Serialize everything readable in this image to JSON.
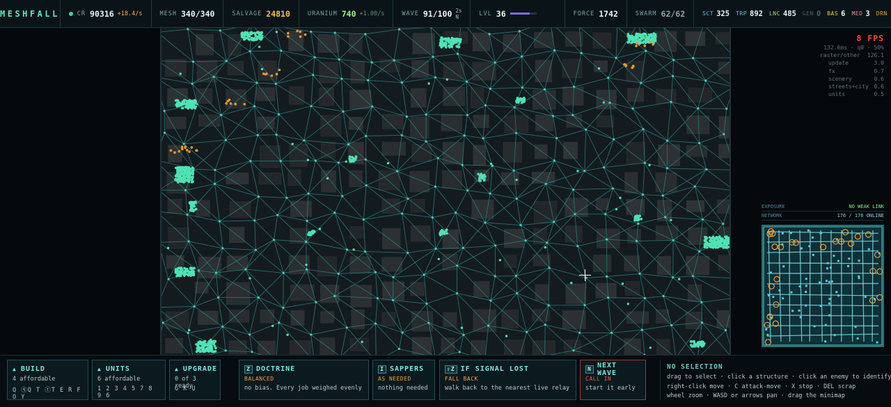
{
  "app": {
    "title": "MESHFALL"
  },
  "hud": {
    "credits": {
      "label": "CR",
      "value": "90316",
      "rate": "+18.4/s"
    },
    "mesh": {
      "label": "MESH",
      "value": "340/340"
    },
    "salvage": {
      "label": "SALVAGE",
      "value": "24810"
    },
    "uranium": {
      "label": "URANIUM",
      "value": "740",
      "rate": "+1.00/s"
    },
    "wave": {
      "label": "WAVE",
      "value": "91/100",
      "timer": "2s",
      "key": "N"
    },
    "level": {
      "label": "LVL",
      "value": "36",
      "progress": 0.75
    },
    "force": {
      "label": "FORCE",
      "value": "1742"
    },
    "swarm": {
      "label": "SWARM",
      "value": "62/62"
    },
    "units": [
      {
        "key": "SCT",
        "value": "325",
        "color": "#5fc6d8"
      },
      {
        "key": "TRP",
        "value": "892",
        "color": "#5fc6d8"
      },
      {
        "key": "LNC",
        "value": "485",
        "color": "#8fe07a"
      },
      {
        "key": "GEN",
        "value": "0",
        "color": "#4b5d62"
      },
      {
        "key": "BAS",
        "value": "6",
        "color": "#e0c94a"
      },
      {
        "key": "MED",
        "value": "3",
        "color": "#e08c8c"
      },
      {
        "key": "DRN",
        "value": "",
        "color": "#e0a04a"
      }
    ]
  },
  "colors": {
    "credits_rate": "#f0b45a",
    "salvage": "#f3c24a",
    "uranium": "#9ef07a",
    "uranium_rate": "#6f8f74",
    "swarm": "#8aa3a8",
    "unit_green": "#4fe3b4",
    "enemy_orange": "#f59a2a",
    "fps": "#ff4a3a",
    "ok_green": "#7ef08f",
    "warn_orange": "#f0a03a"
  },
  "perf": {
    "fps": "8 FPS",
    "summary": "132.6ms · q0 · 50%",
    "rows": [
      {
        "label": "raster/other",
        "value": "126.1"
      },
      {
        "label": "update",
        "value": "3.0"
      },
      {
        "label": "fx",
        "value": "0.7"
      },
      {
        "label": "scenery",
        "value": "0.6"
      },
      {
        "label": "streets+city",
        "value": "0.6"
      },
      {
        "label": "units",
        "value": "0.5"
      }
    ]
  },
  "minimap": {
    "exposure": {
      "label": "EXPOSURE",
      "value": "NO WEAK LINK"
    },
    "network": {
      "label": "NETWORK",
      "value": "176 / 176 ONLINE"
    }
  },
  "bottom": {
    "build": {
      "arrow": "▲",
      "title": "BUILD",
      "sub": "4 affordable",
      "keys": "Q ⓠQ T ⓣT E R F O Y"
    },
    "units": {
      "arrow": "▲",
      "title": "UNITS",
      "sub": "6 affordable",
      "keys": "1 2 3 4 5 7 8 9 6"
    },
    "upgrade": {
      "arrow": "▲",
      "title": "UPGRADE",
      "sub": "0 of 3 ready",
      "keys": "G K U"
    },
    "doctrine": {
      "key": "Z",
      "title": "DOCTRINE",
      "mode": "BALANCED",
      "desc": "no bias. Every job weighed evenly"
    },
    "sappers": {
      "key": "I",
      "title": "SAPPERS",
      "mode": "AS NEEDED",
      "desc": "nothing needed"
    },
    "signal": {
      "key": "⇧Z",
      "title": "IF SIGNAL LOST",
      "mode": "FALL BACK",
      "desc": "walk back to the nearest live relay"
    },
    "next_wave": {
      "key": "N",
      "title": "NEXT WAVE",
      "mode": "CALL IN",
      "desc": "start it early"
    },
    "selection": {
      "title": "NO SELECTION",
      "lines": [
        "drag to select · click a structure · click an enemy to identify it",
        "right-click move · C attack-move · X stop · DEL scrap",
        "wheel zoom · WASD or arrows pan · drag the minimap"
      ]
    }
  }
}
